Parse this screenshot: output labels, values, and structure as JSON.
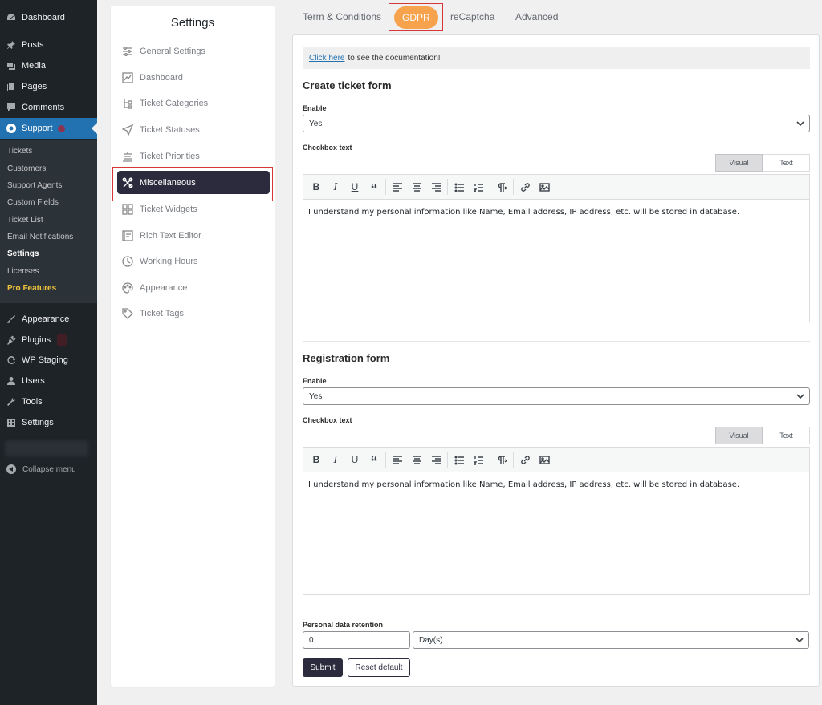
{
  "wp_menu": {
    "items": [
      {
        "label": "Dashboard",
        "icon": "dashboard-icon"
      },
      {
        "label": "Posts",
        "icon": "pin-icon"
      },
      {
        "label": "Media",
        "icon": "media-icon"
      },
      {
        "label": "Pages",
        "icon": "pages-icon"
      },
      {
        "label": "Comments",
        "icon": "comment-icon"
      },
      {
        "label": "Support",
        "icon": "support-icon"
      }
    ],
    "submenu": [
      "Tickets",
      "Customers",
      "Support Agents",
      "Custom Fields",
      "Ticket List",
      "Email Notifications",
      "Settings",
      "Licenses",
      "Pro Features"
    ],
    "items_bottom": [
      {
        "label": "Appearance",
        "icon": "brush-icon"
      },
      {
        "label": "Plugins",
        "icon": "plug-icon"
      },
      {
        "label": "WP Staging",
        "icon": "refresh-icon"
      },
      {
        "label": "Users",
        "icon": "user-icon"
      },
      {
        "label": "Tools",
        "icon": "wrench-icon"
      },
      {
        "label": "Settings",
        "icon": "settings-icon"
      }
    ],
    "collapse_label": "Collapse menu"
  },
  "settings": {
    "title": "Settings",
    "items": [
      {
        "label": "General Settings",
        "icon": "sliders-icon"
      },
      {
        "label": "Dashboard",
        "icon": "chart-icon"
      },
      {
        "label": "Ticket Categories",
        "icon": "tree-icon"
      },
      {
        "label": "Ticket Statuses",
        "icon": "send-icon"
      },
      {
        "label": "Ticket Priorities",
        "icon": "priority-icon"
      },
      {
        "label": "Miscellaneous",
        "icon": "tools-icon"
      },
      {
        "label": "Ticket Widgets",
        "icon": "widgets-icon"
      },
      {
        "label": "Rich Text Editor",
        "icon": "editor-icon"
      },
      {
        "label": "Working Hours",
        "icon": "clock-icon"
      },
      {
        "label": "Appearance",
        "icon": "palette-icon"
      },
      {
        "label": "Ticket Tags",
        "icon": "tag-icon"
      }
    ]
  },
  "tabs": [
    "Term & Conditions",
    "GDPR",
    "reCaptcha",
    "Advanced"
  ],
  "doc": {
    "link": "Click here",
    "text": "to see the documentation!"
  },
  "create_form": {
    "title": "Create ticket form",
    "enable_label": "Enable",
    "enable_value": "Yes",
    "checkbox_label": "Checkbox text",
    "text": "I understand my personal information like Name, Email address, IP address, etc. will be stored in database."
  },
  "registration_form": {
    "title": "Registration form",
    "enable_label": "Enable",
    "enable_value": "Yes",
    "checkbox_label": "Checkbox text",
    "text": "I understand my personal information like Name, Email address, IP address, etc. will be stored in database."
  },
  "editor": {
    "visual": "Visual",
    "text": "Text",
    "bold": "B",
    "italic": "I",
    "underline": "U",
    "quote": "“"
  },
  "retention": {
    "label": "Personal data retention",
    "value": "0",
    "unit": "Day(s)"
  },
  "buttons": {
    "submit": "Submit",
    "reset": "Reset default"
  },
  "colors": {
    "accent": "#f7a24d",
    "dark": "#2c2b3e",
    "wp_blue": "#2271b1",
    "sidebar": "#1d2327"
  }
}
